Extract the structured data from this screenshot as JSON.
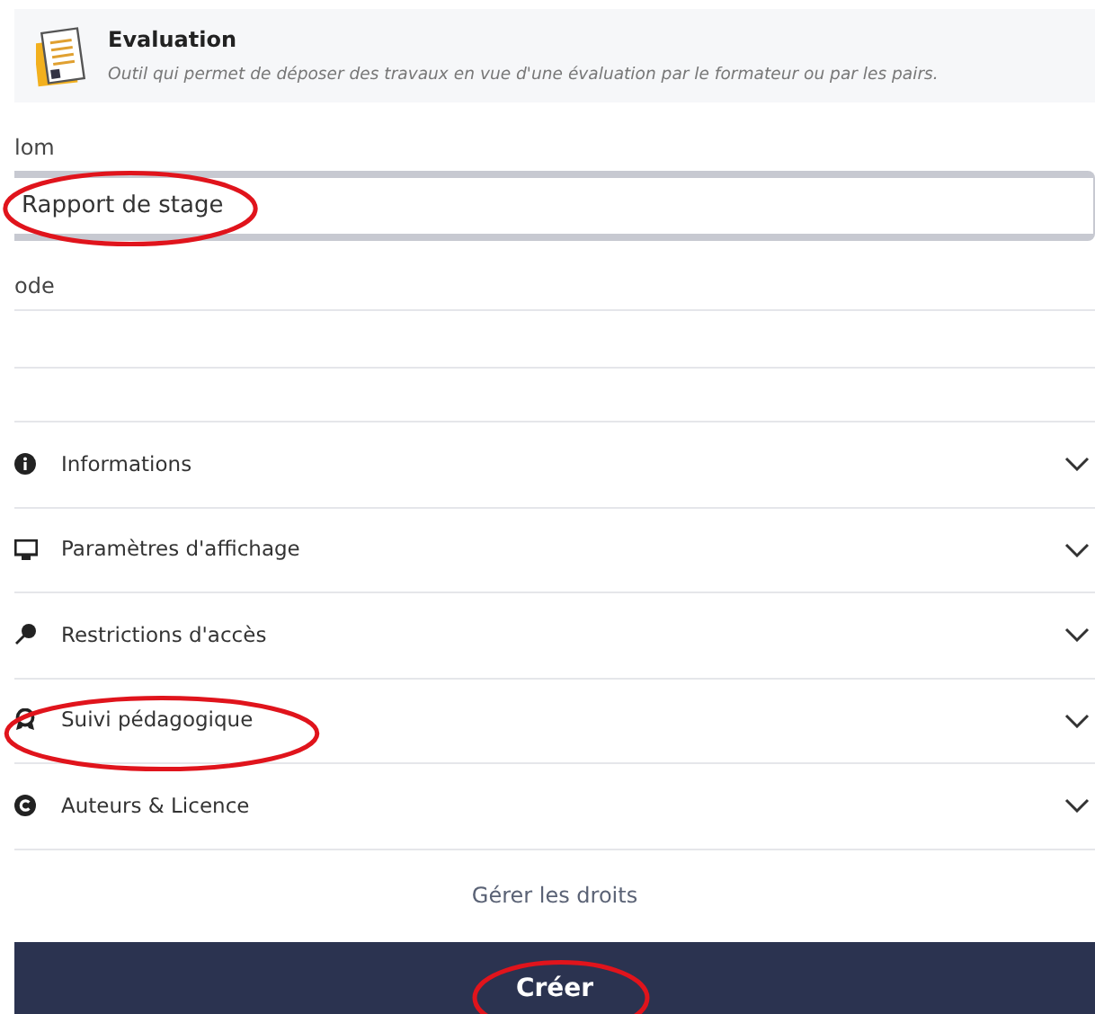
{
  "tool": {
    "title": "Evaluation",
    "description": "Outil qui permet de déposer des travaux en vue d'une évaluation par le formateur ou par les pairs."
  },
  "fields": [
    {
      "label": "lom",
      "value": "Rapport de stage",
      "focused": true,
      "circled": true
    },
    {
      "label": "ode",
      "focused": false,
      "circled": false
    }
  ],
  "sections": [
    {
      "kind": "info",
      "label": "Informations",
      "expanded": false,
      "circled": false
    },
    {
      "kind": "display",
      "label": "Paramètres d'affichage",
      "expanded": false,
      "circled": false
    },
    {
      "kind": "access",
      "label": "Restrictions d'accès",
      "expanded": false,
      "circled": false
    },
    {
      "kind": "tracking",
      "label": "Suivi pédagogique",
      "expanded": false,
      "circled": true
    },
    {
      "kind": "license",
      "label": "Auteurs & Licence",
      "expanded": false,
      "circled": false
    }
  ],
  "rights_link": "Gérer les droits",
  "create_button": {
    "label": "Créer",
    "circled": true
  }
}
